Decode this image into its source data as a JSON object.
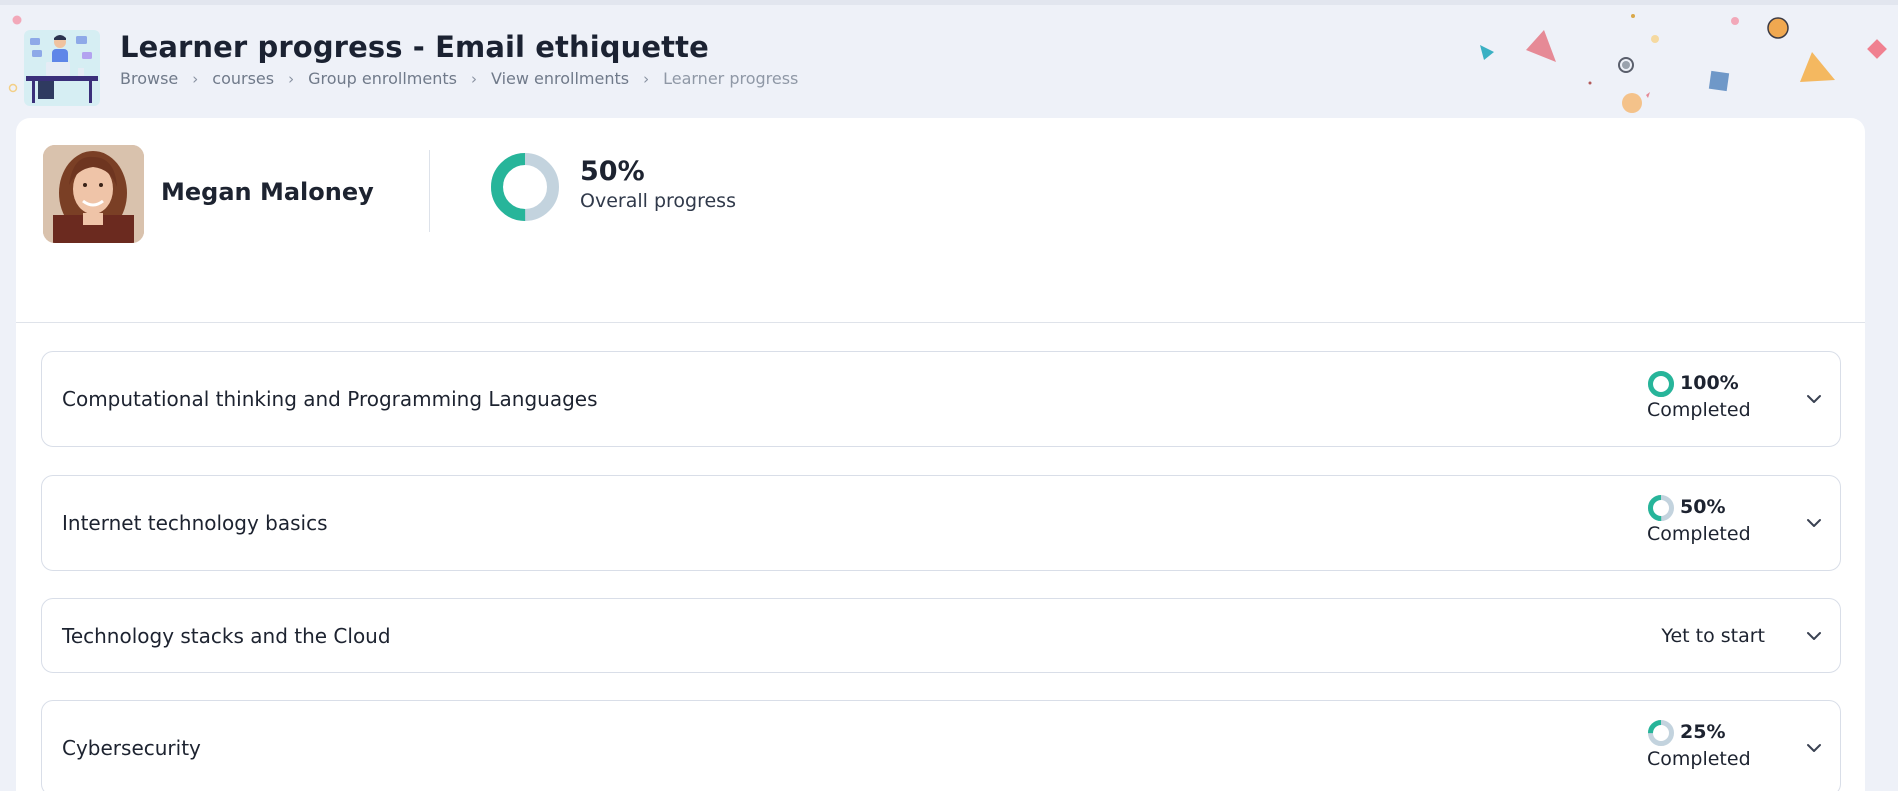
{
  "page": {
    "title": "Learner progress - Email ethiquette",
    "breadcrumb": [
      "Browse",
      "courses",
      "Group enrollments",
      "View enrollments",
      "Learner progress"
    ]
  },
  "learner": {
    "name": "Megan Maloney",
    "overall_progress_value": 50,
    "overall_progress_text": "50%",
    "overall_progress_label": "Overall progress"
  },
  "colors": {
    "accent": "#27b59a",
    "track": "#c3d3de",
    "title": "#1b2232"
  },
  "courses": [
    {
      "title": "Computational thinking and Programming Languages",
      "progress_value": 100,
      "progress_text": "100%",
      "status": "Completed"
    },
    {
      "title": "Internet technology basics",
      "progress_value": 50,
      "progress_text": "50%",
      "status": "Completed"
    },
    {
      "title": "Technology stacks and the Cloud",
      "progress_value": null,
      "progress_text": "",
      "status": "Yet to start"
    },
    {
      "title": "Cybersecurity",
      "progress_value": 25,
      "progress_text": "25%",
      "status": "Completed"
    }
  ],
  "icons": {
    "expand": "chevron-down-icon",
    "hero": "desk-illustration-icon"
  }
}
